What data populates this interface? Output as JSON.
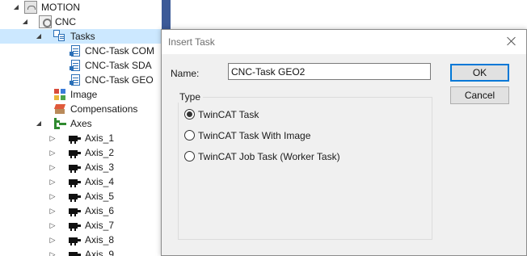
{
  "tree": {
    "items": [
      {
        "label": "MOTION",
        "icon": "motion-icon",
        "expanded": true
      },
      {
        "label": "CNC",
        "icon": "cnc-icon",
        "expanded": true
      },
      {
        "label": "Tasks",
        "icon": "tasks-icon",
        "expanded": true,
        "selected": true
      },
      {
        "label": "CNC-Task COM",
        "icon": "task-icon"
      },
      {
        "label": "CNC-Task SDA",
        "icon": "task-icon"
      },
      {
        "label": "CNC-Task GEO",
        "icon": "task-icon"
      },
      {
        "label": "Image",
        "icon": "image-icon"
      },
      {
        "label": "Compensations",
        "icon": "compensations-icon"
      },
      {
        "label": "Axes",
        "icon": "axes-icon",
        "expanded": true
      },
      {
        "label": "Axis_1",
        "icon": "axis-icon",
        "expanded": false
      },
      {
        "label": "Axis_2",
        "icon": "axis-icon",
        "expanded": false
      },
      {
        "label": "Axis_3",
        "icon": "axis-icon",
        "expanded": false
      },
      {
        "label": "Axis_4",
        "icon": "axis-icon",
        "expanded": false
      },
      {
        "label": "Axis_5",
        "icon": "axis-icon",
        "expanded": false
      },
      {
        "label": "Axis_6",
        "icon": "axis-icon",
        "expanded": false
      },
      {
        "label": "Axis_7",
        "icon": "axis-icon",
        "expanded": false
      },
      {
        "label": "Axis_8",
        "icon": "axis-icon",
        "expanded": false
      },
      {
        "label": "Axis_9",
        "icon": "axis-icon",
        "expanded": false
      }
    ]
  },
  "dialog": {
    "title": "Insert Task",
    "name_label": "Name:",
    "name_value": "CNC-Task GEO2",
    "ok_label": "OK",
    "cancel_label": "Cancel",
    "type_legend": "Type",
    "options": [
      {
        "label": "TwinCAT Task",
        "checked": true
      },
      {
        "label": "TwinCAT Task With Image",
        "checked": false
      },
      {
        "label": "TwinCAT Job Task (Worker Task)",
        "checked": false
      }
    ]
  },
  "colors": {
    "selection": "#cce8ff",
    "splitter": "#3c5a98",
    "task_icon": "#2a6fb7",
    "axes_icon": "#2f8a2f"
  }
}
